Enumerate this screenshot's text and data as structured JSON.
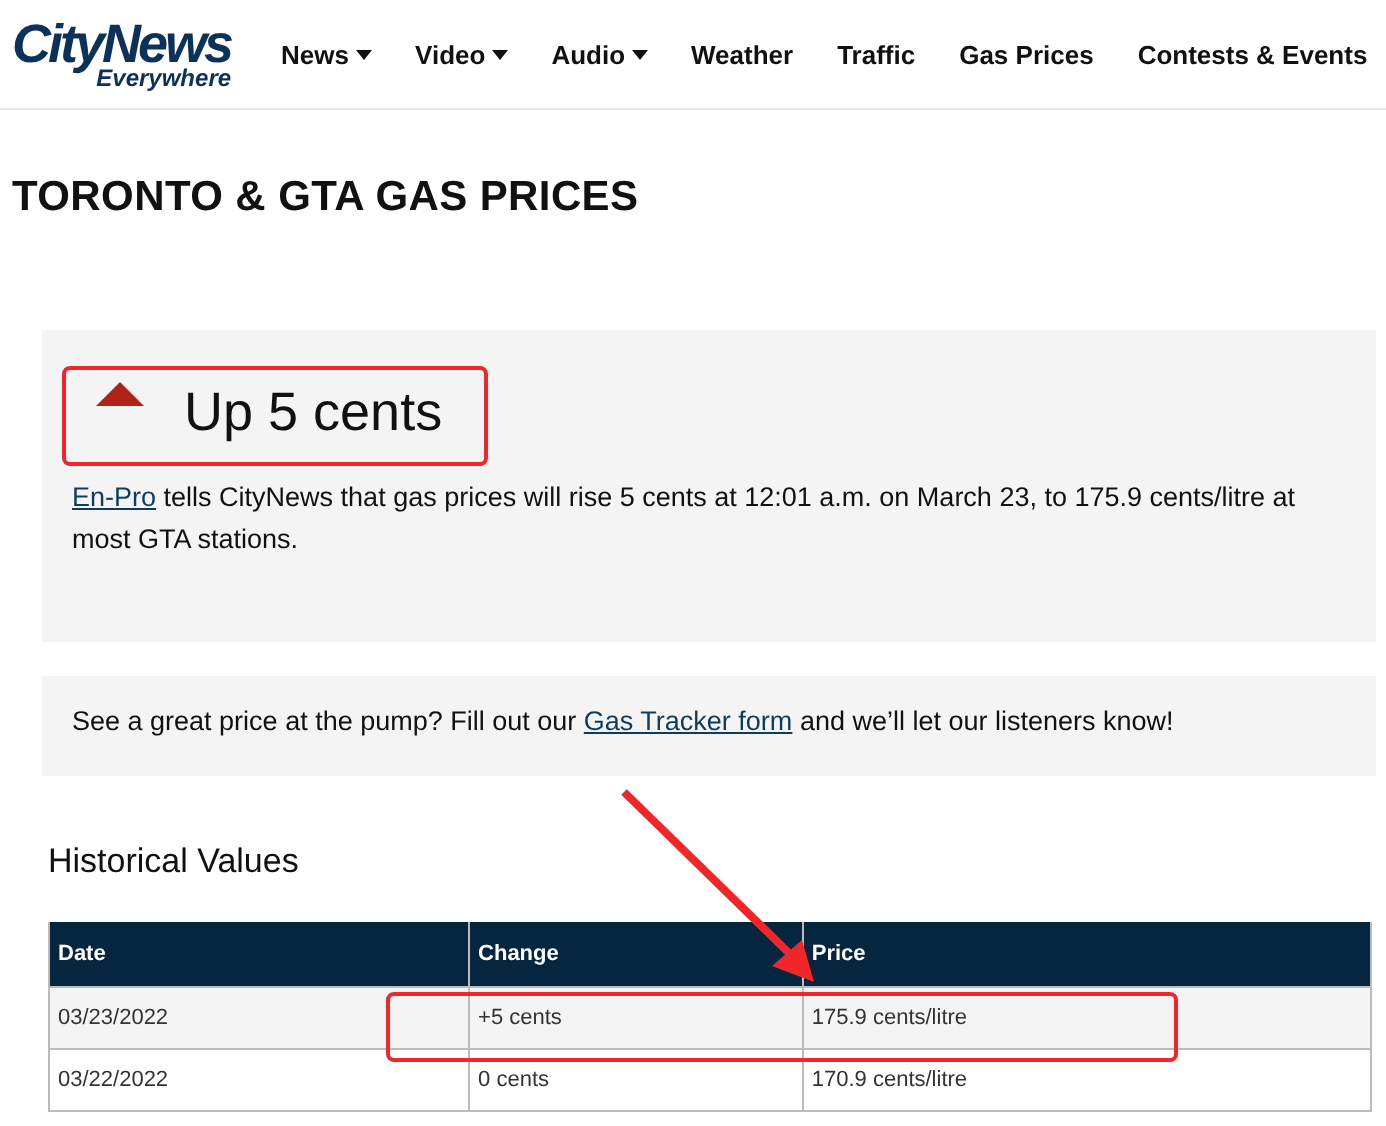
{
  "header": {
    "logo": {
      "main": "CityNews",
      "sub": "Everywhere"
    },
    "nav": [
      {
        "label": "News",
        "dropdown": true
      },
      {
        "label": "Video",
        "dropdown": true
      },
      {
        "label": "Audio",
        "dropdown": true
      },
      {
        "label": "Weather",
        "dropdown": false
      },
      {
        "label": "Traffic",
        "dropdown": false
      },
      {
        "label": "Gas Prices",
        "dropdown": false
      },
      {
        "label": "Contests & Events",
        "dropdown": false
      }
    ]
  },
  "page_title": "TORONTO & GTA GAS PRICES",
  "forecast": {
    "rising": true,
    "headline": "Up 5 cents",
    "link": "En-Pro",
    "text": " tells CityNews that gas prices will rise 5 cents at 12:01 a.m. on March 23, to 175.9 cents/litre at most GTA stations."
  },
  "tracker": {
    "before": "See a great price at the pump? Fill out our ",
    "link": "Gas Tracker form",
    "after": " and we’ll let our listeners know!"
  },
  "history": {
    "title": "Historical Values",
    "columns": [
      "Date",
      "Change",
      "Price"
    ],
    "rows": [
      [
        "03/23/2022",
        "+5 cents",
        "175.9 cents/litre"
      ],
      [
        "03/22/2022",
        "0 cents",
        "170.9 cents/litre"
      ]
    ]
  }
}
